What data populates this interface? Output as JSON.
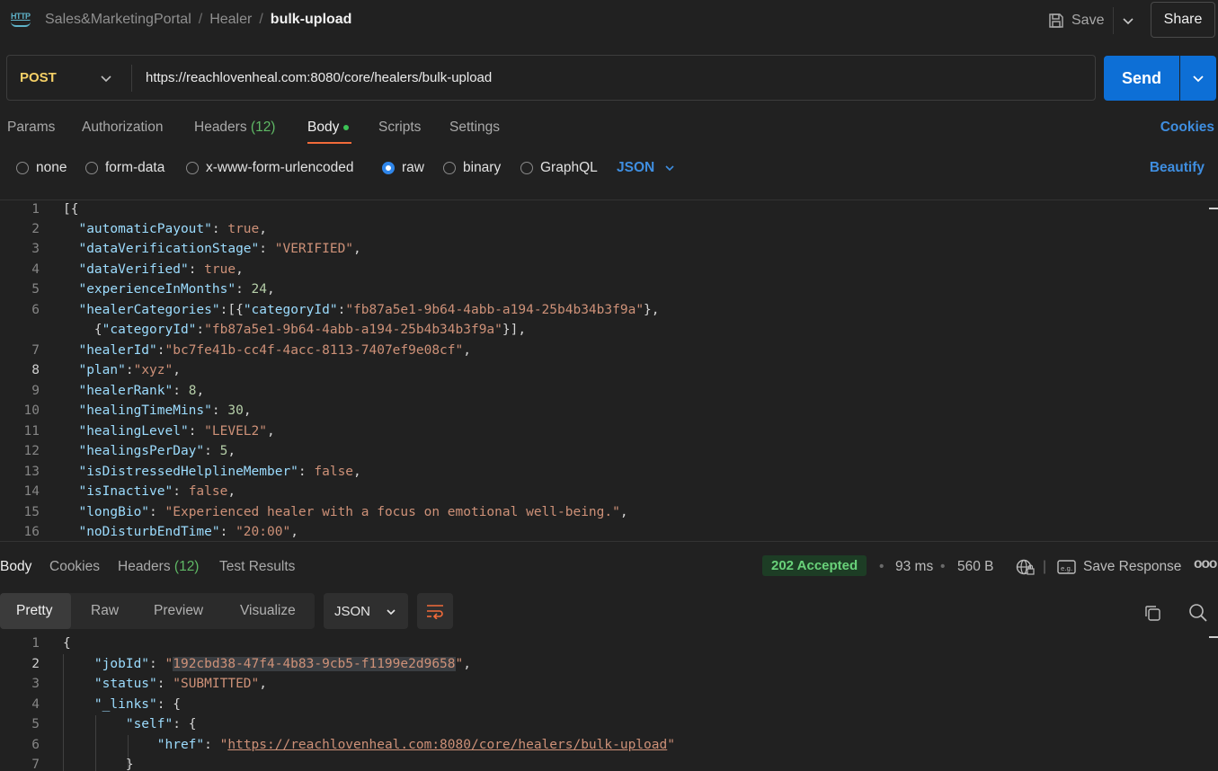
{
  "breadcrumb": {
    "items": [
      "Sales&MarketingPortal",
      "Healer"
    ],
    "separator": "/",
    "current": "bulk-upload"
  },
  "header": {
    "save_label": "Save",
    "share_label": "Share"
  },
  "request": {
    "method": "POST",
    "url": "https://reachlovenheal.com:8080/core/healers/bulk-upload",
    "send_label": "Send",
    "tabs": {
      "params": "Params",
      "authorization": "Authorization",
      "headers": "Headers",
      "headers_count": "(12)",
      "body": "Body",
      "scripts": "Scripts",
      "settings": "Settings"
    },
    "cookies_label": "Cookies",
    "body_types": [
      "none",
      "form-data",
      "x-www-form-urlencoded",
      "raw",
      "binary",
      "GraphQL"
    ],
    "selected_body_type": "raw",
    "language": "JSON",
    "beautify_label": "Beautify",
    "line_numbers": [
      "1",
      "2",
      "3",
      "4",
      "5",
      "6",
      "",
      "7",
      "8",
      "9",
      "10",
      "11",
      "12",
      "13",
      "14",
      "15",
      "16"
    ],
    "code": {
      "l1": "[{",
      "l2k": "\"automaticPayout\"",
      "l2v": "true",
      "l3k": "\"dataVerificationStage\"",
      "l3v": "\"VERIFIED\"",
      "l4k": "\"dataVerified\"",
      "l4v": "true",
      "l5k": "\"experienceInMonths\"",
      "l5v": "24",
      "l6k": "\"healerCategories\"",
      "l6a": "\"categoryId\"",
      "l6b": "\"fb87a5e1-9b64-4abb-a194-25b4b34b3f9a\"",
      "l6c": "\"categoryId\"",
      "l6d": "\"fb87a5e1-9b64-4abb-a194-25b4b34b3f9a\"",
      "l7k": "\"healerId\"",
      "l7v": "\"bc7fe41b-cc4f-4acc-8113-7407ef9e08cf\"",
      "l8k": "\"plan\"",
      "l8v": "\"xyz\"",
      "l9k": "\"healerRank\"",
      "l9v": "8",
      "l10k": "\"healingTimeMins\"",
      "l10v": "30",
      "l11k": "\"healingLevel\"",
      "l11v": "\"LEVEL2\"",
      "l12k": "\"healingsPerDay\"",
      "l12v": "5",
      "l13k": "\"isDistressedHelplineMember\"",
      "l13v": "false",
      "l14k": "\"isInactive\"",
      "l14v": "false",
      "l15k": "\"longBio\"",
      "l15v": "\"Experienced healer with a focus on emotional well-being.\"",
      "l16k": "\"noDisturbEndTime\"",
      "l16v": "\"20:00\""
    }
  },
  "response": {
    "tabs": {
      "body": "Body",
      "cookies": "Cookies",
      "headers": "Headers",
      "headers_count": "(12)",
      "test_results": "Test Results"
    },
    "status": "202 Accepted",
    "time": "93 ms",
    "size": "560 B",
    "save_response_label": "Save Response",
    "more_label": "ooo",
    "formats": [
      "Pretty",
      "Raw",
      "Preview",
      "Visualize"
    ],
    "language": "JSON",
    "line_numbers": [
      "1",
      "2",
      "3",
      "4",
      "5",
      "6",
      "7"
    ],
    "code": {
      "l1": "{",
      "l2k": "\"jobId\"",
      "l2v": "192cbd38-47f4-4b83-9cb5-f1199e2d9658",
      "l3k": "\"status\"",
      "l3v": "\"SUBMITTED\"",
      "l4k": "\"_links\"",
      "l4v": "{",
      "l5k": "\"self\"",
      "l5v": "{",
      "l6k": "\"href\"",
      "l6v": "https://reachlovenheal.com:8080/core/healers/bulk-upload",
      "l7": "}"
    }
  },
  "colors": {
    "accent": "#0d6fd6",
    "method": "#f5d066",
    "active_tab_underline": "#f26b3a",
    "status_ok": "#69d27a"
  }
}
